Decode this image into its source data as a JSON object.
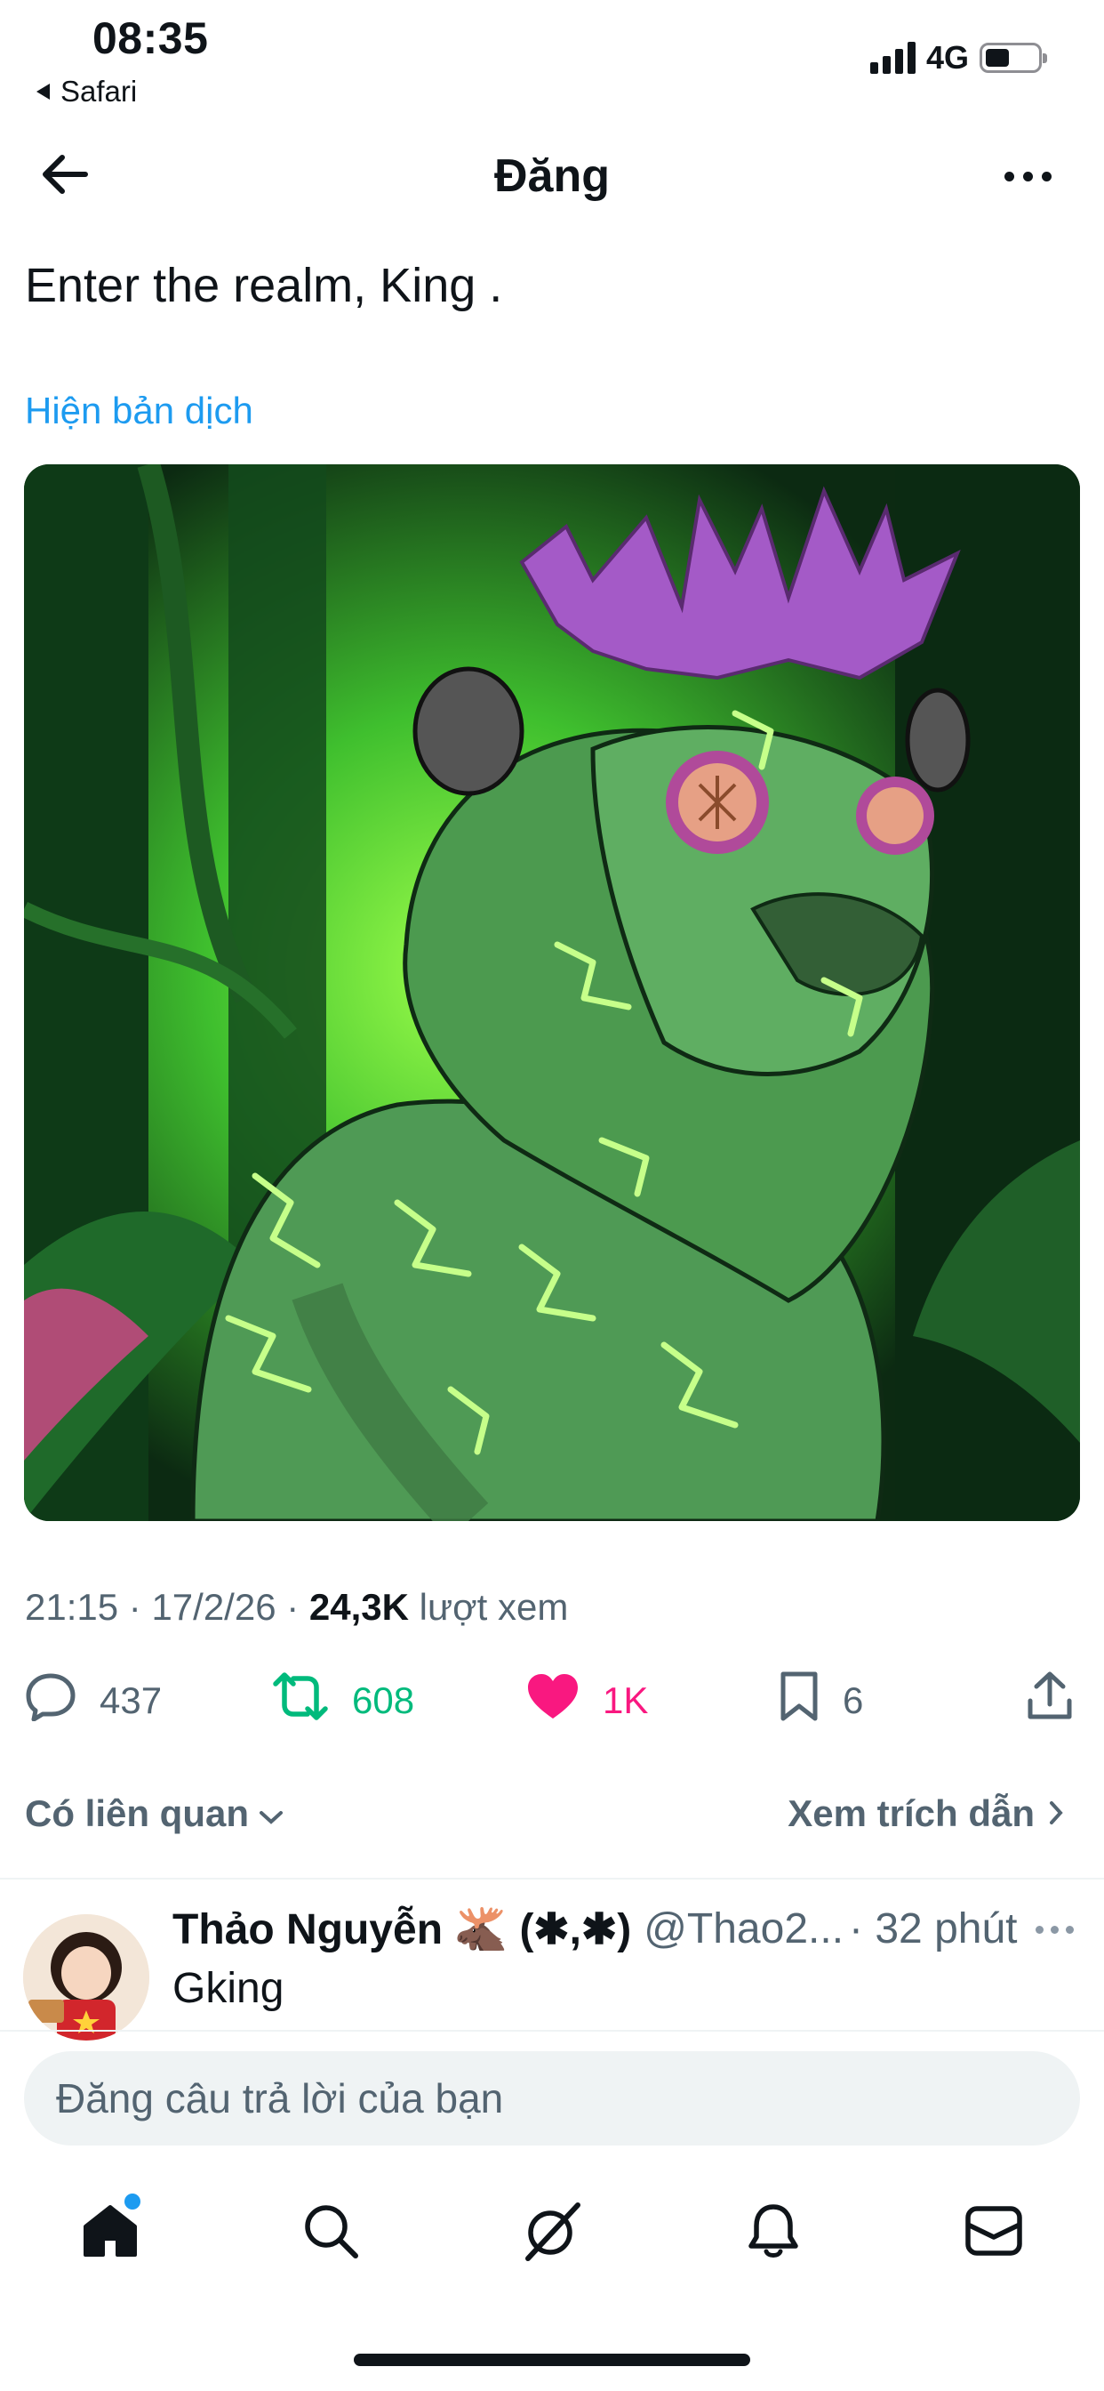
{
  "status_bar": {
    "time": "08:35",
    "back_app": "Safari",
    "network": "4G"
  },
  "header": {
    "title": "Đăng"
  },
  "post": {
    "text": "Enter the realm, King .",
    "translate_link": "Hiện bản dịch",
    "meta": {
      "time": "21:15",
      "date": "17/2/26",
      "views": "24,3K",
      "views_label": "lượt xem"
    },
    "actions": {
      "replies": "437",
      "reposts": "608",
      "likes": "1K",
      "bookmarks": "6"
    },
    "related_label": "Có liên quan",
    "quotes_label": "Xem trích dẫn"
  },
  "reply": {
    "name": "Thảo Nguyễn 🫎 (✱,✱)",
    "handle": "@Thao2...",
    "time": "· 32 phút",
    "text": "Gking"
  },
  "composer": {
    "placeholder": "Đăng câu trả lời của bạn"
  },
  "tabbar": {
    "items": [
      "home-icon",
      "search-icon",
      "grok-icon",
      "notifications-icon",
      "messages-icon"
    ]
  },
  "colors": {
    "accent": "#1d9bf0",
    "repost": "#00ba7c",
    "like": "#f91880",
    "muted": "#536471"
  }
}
